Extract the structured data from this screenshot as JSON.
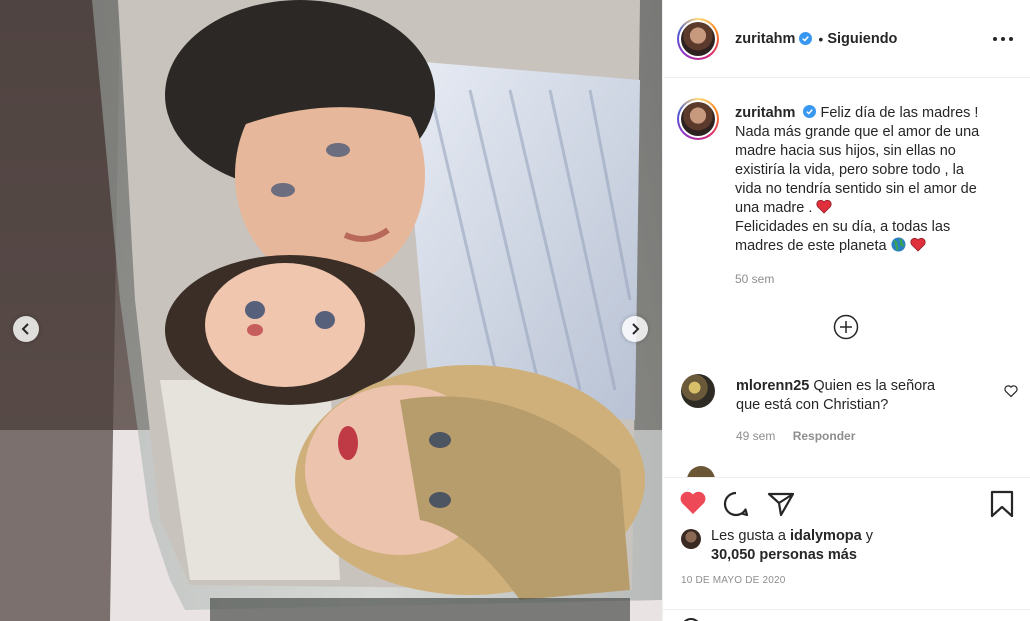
{
  "post": {
    "username": "zuritahm",
    "follow_separator": "•",
    "follow_status": "Siguiendo",
    "caption": {
      "lines": [
        "Feliz día de las madres !",
        "Nada más grande que el amor de una",
        "madre hacia sus hijos, sin ellas no",
        "existiría la vida, pero sobre todo , la",
        "vida no tendría sentido sin el amor de",
        "una madre .",
        "Felicidades en su día, a todas las",
        "madres de este planeta"
      ],
      "time_ago": "50 sem"
    },
    "comments": [
      {
        "username": "mlorenn25",
        "text_line1": "Quien es la señora",
        "text_line2": "que está con Christian?",
        "time_ago": "49 sem",
        "reply_label": "Responder"
      }
    ],
    "likes": {
      "prefix": "Les gusta a",
      "liker": "idalymopa",
      "connector": "y",
      "count_text": "30,050 personas más"
    },
    "date": "10 de mayo de 2020"
  },
  "icons": {
    "verified": "verified-badge-icon",
    "more": "more-options-icon",
    "add_comments": "plus-circle-icon",
    "like_comment": "heart-outline-icon",
    "like_post": "heart-filled-icon",
    "comment": "comment-icon",
    "share": "share-icon",
    "save": "bookmark-icon",
    "prev": "chevron-left-icon",
    "next": "chevron-right-icon"
  },
  "colors": {
    "accent_blue": "#3897f0",
    "like_red": "#ed4956",
    "text_primary": "#262626",
    "text_secondary": "#8e8e8e"
  }
}
